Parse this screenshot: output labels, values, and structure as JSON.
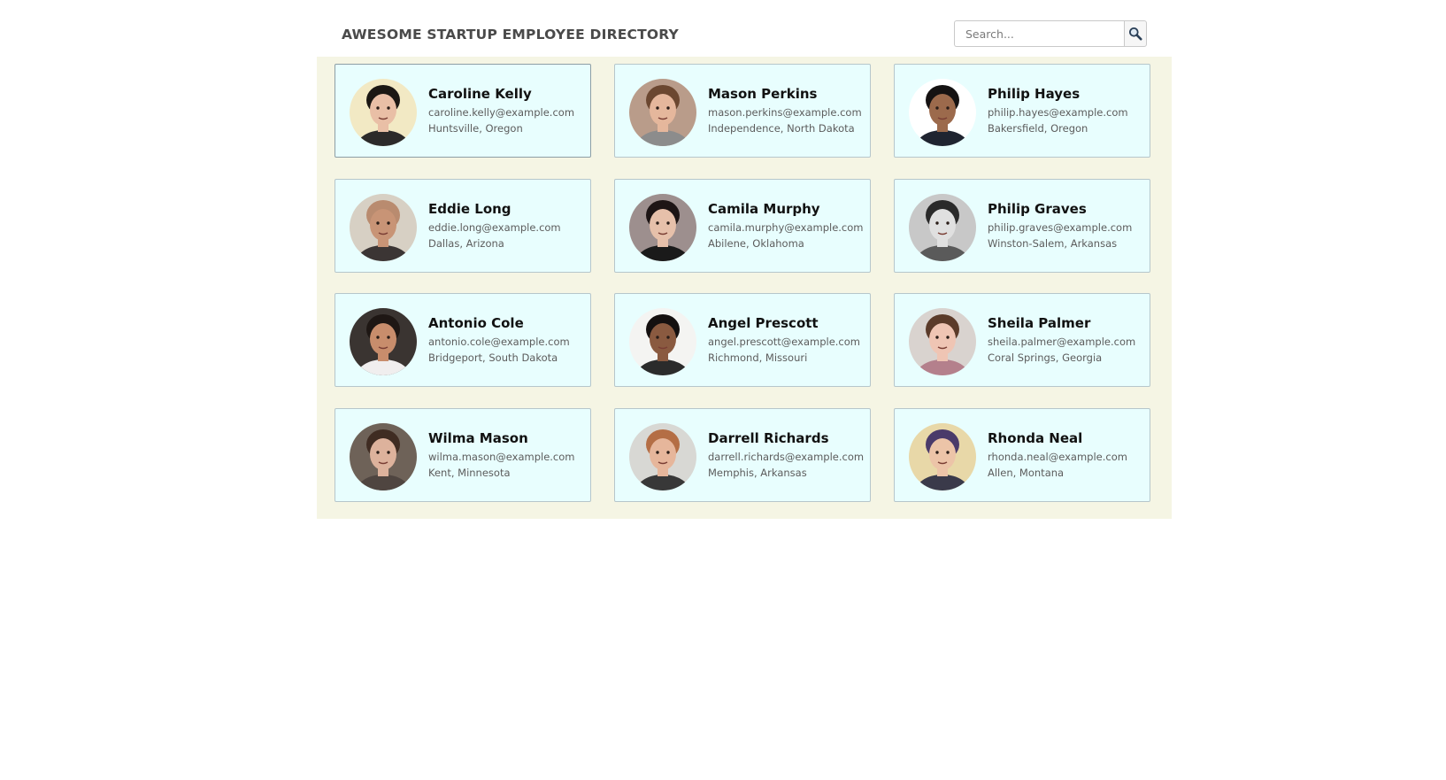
{
  "header": {
    "title": "AWESOME STARTUP EMPLOYEE DIRECTORY",
    "search_placeholder": "Search...",
    "search_icon": "magnifier-icon"
  },
  "colors": {
    "gallery_background": "#f5f5e4",
    "card_background": "#e8fefe",
    "card_border": "#b6c6cb",
    "title_text": "#4a4a4a"
  },
  "employees": [
    {
      "name": "Caroline Kelly",
      "email": "caroline.kelly@example.com",
      "location": "Huntsville, Oregon",
      "avatar_bg": "#f2e9c4",
      "avatar_skin": "#e9bfa6",
      "avatar_hair": "#1b1713",
      "avatar_shirt": "#2c2a2a"
    },
    {
      "name": "Mason Perkins",
      "email": "mason.perkins@example.com",
      "location": "Independence, North Dakota",
      "avatar_bg": "#b99c8a",
      "avatar_skin": "#e5b79c",
      "avatar_hair": "#6b4730",
      "avatar_shirt": "#8c8c8c"
    },
    {
      "name": "Philip Hayes",
      "email": "philip.hayes@example.com",
      "location": "Bakersfield, Oregon",
      "avatar_bg": "#ffffff",
      "avatar_skin": "#9c6a4c",
      "avatar_hair": "#151212",
      "avatar_shirt": "#1f2430"
    },
    {
      "name": "Eddie Long",
      "email": "eddie.long@example.com",
      "location": "Dallas, Arizona",
      "avatar_bg": "#d7d0c4",
      "avatar_skin": "#c89476",
      "avatar_hair": "#b98b6f",
      "avatar_shirt": "#3b3534"
    },
    {
      "name": "Camila Murphy",
      "email": "camila.murphy@example.com",
      "location": "Abilene, Oklahoma",
      "avatar_bg": "#9d8f8e",
      "avatar_skin": "#e6c0aa",
      "avatar_hair": "#1d1515",
      "avatar_shirt": "#1a1a1a"
    },
    {
      "name": "Philip Graves",
      "email": "philip.graves@example.com",
      "location": "Winston-Salem, Arkansas",
      "avatar_bg": "#c8c8c8",
      "avatar_skin": "#e0e0e0",
      "avatar_hair": "#2a2a2a",
      "avatar_shirt": "#5a5a5a"
    },
    {
      "name": "Antonio Cole",
      "email": "antonio.cole@example.com",
      "location": "Bridgeport, South Dakota",
      "avatar_bg": "#3a3431",
      "avatar_skin": "#c88d6c",
      "avatar_hair": "#1e1714",
      "avatar_shirt": "#f0eeee"
    },
    {
      "name": "Angel Prescott",
      "email": "angel.prescott@example.com",
      "location": "Richmond, Missouri",
      "avatar_bg": "#f4f4f2",
      "avatar_skin": "#8a5a40",
      "avatar_hair": "#141010",
      "avatar_shirt": "#2b2b2b"
    },
    {
      "name": "Sheila Palmer",
      "email": "sheila.palmer@example.com",
      "location": "Coral Springs, Georgia",
      "avatar_bg": "#d9d3cf",
      "avatar_skin": "#efc5b4",
      "avatar_hair": "#5b3b2a",
      "avatar_shirt": "#b4808c"
    },
    {
      "name": "Wilma Mason",
      "email": "wilma.mason@example.com",
      "location": "Kent, Minnesota",
      "avatar_bg": "#6e6258",
      "avatar_skin": "#ddb29c",
      "avatar_hair": "#3f2c22",
      "avatar_shirt": "#4f4540"
    },
    {
      "name": "Darrell Richards",
      "email": "darrell.richards@example.com",
      "location": "Memphis, Arkansas",
      "avatar_bg": "#d8d8d4",
      "avatar_skin": "#e6b69b",
      "avatar_hair": "#b46e45",
      "avatar_shirt": "#383838"
    },
    {
      "name": "Rhonda Neal",
      "email": "rhonda.neal@example.com",
      "location": "Allen, Montana",
      "avatar_bg": "#e8d8a8",
      "avatar_skin": "#ecc4a8",
      "avatar_hair": "#4a3a6a",
      "avatar_shirt": "#3a3a4a"
    }
  ]
}
